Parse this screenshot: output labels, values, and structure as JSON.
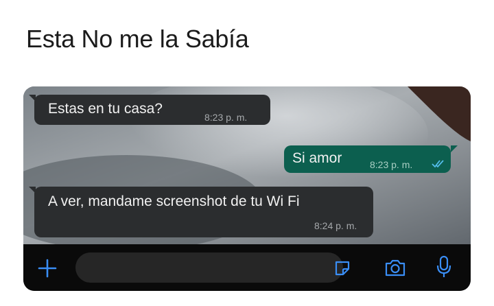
{
  "caption": "Esta No me la Sabía",
  "messages": [
    {
      "direction": "incoming",
      "text": "Estas en tu casa?",
      "time": "8:23 p. m."
    },
    {
      "direction": "outgoing",
      "text": "Si amor",
      "time": "8:23 p. m.",
      "status": "read"
    },
    {
      "direction": "incoming",
      "text": "A ver, mandame screenshot de tu Wi Fi",
      "time": "8:24 p. m."
    }
  ],
  "composer": {
    "placeholder": ""
  },
  "icons": {
    "add": "plus-icon",
    "sticker": "sticker-icon",
    "camera": "camera-icon",
    "microphone": "microphone-icon"
  },
  "colors": {
    "incoming_bubble": "#2b2d2f",
    "outgoing_bubble": "#0c5f4f",
    "accent": "#3a8ef6",
    "read_ticks": "#53bdeb"
  }
}
